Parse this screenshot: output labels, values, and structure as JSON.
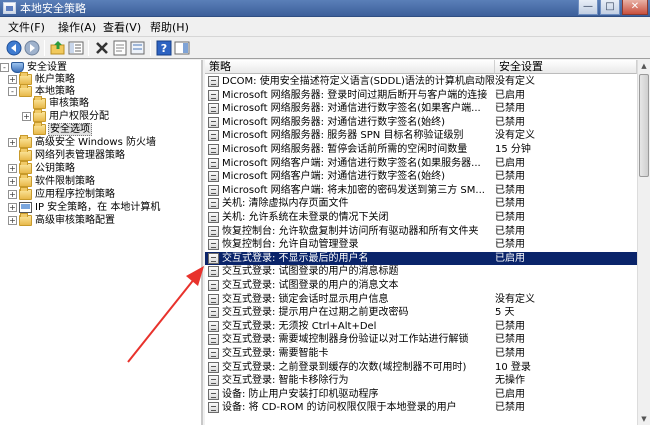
{
  "window": {
    "title": "本地安全策略",
    "controls": {
      "minimize": "—",
      "maximize": "□",
      "close": "✕"
    }
  },
  "menu": [
    {
      "label": "文件(F)"
    },
    {
      "label": "操作(A)"
    },
    {
      "label": "查看(V)"
    },
    {
      "label": "帮助(H)"
    }
  ],
  "toolbar": [
    {
      "name": "back-icon",
      "glyph": "◀"
    },
    {
      "name": "forward-icon",
      "glyph": "▶"
    },
    {
      "name": "up-folder-icon",
      "glyph": "⇧"
    },
    {
      "name": "show-tree-icon",
      "glyph": "▦"
    },
    {
      "name": "delete-icon",
      "glyph": "✖"
    },
    {
      "name": "properties-icon",
      "glyph": "▤"
    },
    {
      "name": "export-list-icon",
      "glyph": "▥"
    },
    {
      "name": "help-icon",
      "glyph": "?"
    },
    {
      "name": "show-hide-pane-icon",
      "glyph": "▣"
    }
  ],
  "tree": [
    {
      "label": "安全设置",
      "level": 0,
      "expander": "-",
      "icon": "shield"
    },
    {
      "label": "帐户策略",
      "level": 1,
      "expander": "+",
      "icon": "folder"
    },
    {
      "label": "本地策略",
      "level": 1,
      "expander": "-",
      "icon": "folder"
    },
    {
      "label": "审核策略",
      "level": 2,
      "expander": "",
      "icon": "folder"
    },
    {
      "label": "用户权限分配",
      "level": 2,
      "expander": "+",
      "icon": "folder"
    },
    {
      "label": "安全选项",
      "level": 2,
      "expander": "",
      "icon": "folder",
      "selected": true
    },
    {
      "label": "高级安全 Windows 防火墙",
      "level": 1,
      "expander": "+",
      "icon": "folder"
    },
    {
      "label": "网络列表管理器策略",
      "level": 1,
      "expander": "",
      "icon": "folder"
    },
    {
      "label": "公钥策略",
      "level": 1,
      "expander": "+",
      "icon": "folder"
    },
    {
      "label": "软件限制策略",
      "level": 1,
      "expander": "+",
      "icon": "folder"
    },
    {
      "label": "应用程序控制策略",
      "level": 1,
      "expander": "+",
      "icon": "folder"
    },
    {
      "label": "IP 安全策略，在 本地计算机",
      "level": 1,
      "expander": "+",
      "icon": "monitor"
    },
    {
      "label": "高级审核策略配置",
      "level": 1,
      "expander": "+",
      "icon": "folder"
    }
  ],
  "columns": {
    "policy": "策略",
    "setting": "安全设置"
  },
  "policies": [
    {
      "name": "DCOM: 使用安全描述符定义语言(SDDL)语法的计算机启动限制",
      "value": "没有定义"
    },
    {
      "name": "Microsoft 网络服务器: 登录时间过期后断开与客户端的连接",
      "value": "已启用"
    },
    {
      "name": "Microsoft 网络服务器: 对通信进行数字签名(如果客户端...",
      "value": "已禁用"
    },
    {
      "name": "Microsoft 网络服务器: 对通信进行数字签名(始终)",
      "value": "已禁用"
    },
    {
      "name": "Microsoft 网络服务器: 服务器 SPN 目标名称验证级别",
      "value": "没有定义"
    },
    {
      "name": "Microsoft 网络服务器: 暂停会话前所需的空闲时间数量",
      "value": "15 分钟"
    },
    {
      "name": "Microsoft 网络客户端: 对通信进行数字签名(如果服务器...",
      "value": "已启用"
    },
    {
      "name": "Microsoft 网络客户端: 对通信进行数字签名(始终)",
      "value": "已禁用"
    },
    {
      "name": "Microsoft 网络客户端: 将未加密的密码发送到第三方 SM...",
      "value": "已禁用"
    },
    {
      "name": "关机: 清除虚拟内存页面文件",
      "value": "已禁用"
    },
    {
      "name": "关机: 允许系统在未登录的情况下关闭",
      "value": "已禁用"
    },
    {
      "name": "恢复控制台: 允许软盘复制并访问所有驱动器和所有文件夹",
      "value": "已禁用"
    },
    {
      "name": "恢复控制台: 允许自动管理登录",
      "value": "已禁用"
    },
    {
      "name": "交互式登录: 不显示最后的用户名",
      "value": "已启用",
      "selected": true
    },
    {
      "name": "交互式登录: 试图登录的用户的消息标题",
      "value": ""
    },
    {
      "name": "交互式登录: 试图登录的用户的消息文本",
      "value": ""
    },
    {
      "name": "交互式登录: 锁定会话时显示用户信息",
      "value": "没有定义"
    },
    {
      "name": "交互式登录: 提示用户在过期之前更改密码",
      "value": "5 天"
    },
    {
      "name": "交互式登录: 无须按 Ctrl+Alt+Del",
      "value": "已禁用"
    },
    {
      "name": "交互式登录: 需要域控制器身份验证以对工作站进行解锁",
      "value": "已禁用"
    },
    {
      "name": "交互式登录: 需要智能卡",
      "value": "已禁用"
    },
    {
      "name": "交互式登录: 之前登录到缓存的次数(域控制器不可用时)",
      "value": "10 登录"
    },
    {
      "name": "交互式登录: 智能卡移除行为",
      "value": "无操作"
    },
    {
      "name": "设备: 防止用户安装打印机驱动程序",
      "value": "已启用"
    },
    {
      "name": "设备: 将 CD-ROM 的访问权限仅限于本地登录的用户",
      "value": "已禁用"
    }
  ],
  "colors": {
    "selection": "#0a246a",
    "annotation_arrow": "#e8322c"
  }
}
